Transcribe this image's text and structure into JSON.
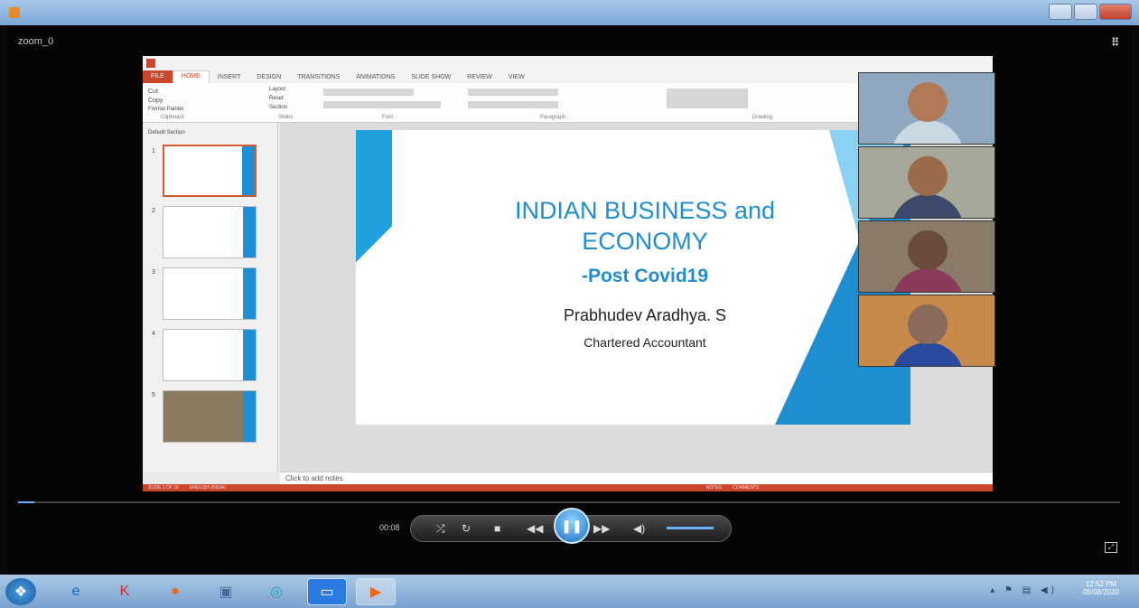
{
  "window": {
    "file_name": "zoom_0"
  },
  "powerpoint": {
    "tabs": [
      "FILE",
      "HOME",
      "INSERT",
      "DESIGN",
      "TRANSITIONS",
      "ANIMATIONS",
      "SLIDE SHOW",
      "REVIEW",
      "VIEW"
    ],
    "ribbon_groups": [
      "Clipboard",
      "Slides",
      "Font",
      "Paragraph",
      "Drawing"
    ],
    "clipboard": {
      "cut": "Cut",
      "copy": "Copy",
      "paste": "Paste",
      "format_painter": "Format Painter"
    },
    "slides_group": {
      "new_slide": "New Slide",
      "layout": "Layout",
      "reset": "Reset",
      "section": "Section"
    },
    "section_label": "Default Section",
    "slide_numbers": [
      "1",
      "2",
      "3",
      "4",
      "5"
    ],
    "notes_placeholder": "Click to add notes",
    "status_left": "SLIDE 1 OF 16",
    "status_lang": "ENGLISH (INDIA)",
    "status_notes": "NOTES",
    "status_comments": "COMMENTS"
  },
  "slide": {
    "title_line1": "INDIAN BUSINESS and",
    "title_line2": "ECONOMY",
    "subtitle": "-Post Covid19",
    "presenter": "Prabhudev Aradhya. S",
    "role": "Chartered Accountant"
  },
  "player": {
    "time": "00:08"
  },
  "taskbar": {
    "time": "12:52 PM",
    "date": "06/08/2020"
  },
  "colors": {
    "accent": "#1f8ed1",
    "ppt_red": "#c9472b"
  }
}
